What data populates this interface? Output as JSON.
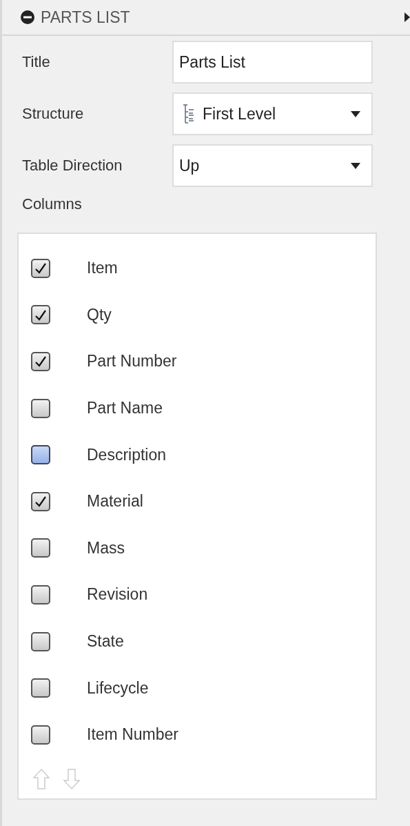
{
  "panel": {
    "title": "PARTS LIST",
    "expanded": true
  },
  "fields": [
    {
      "kind": "text",
      "label": "Title",
      "value": "Parts List"
    },
    {
      "kind": "tree_dropdown",
      "label": "Structure",
      "value": "First Level"
    },
    {
      "kind": "dropdown",
      "label": "Table Direction",
      "value": "Up"
    }
  ],
  "columns_label": "Columns",
  "columns": [
    {
      "label": "Item",
      "checked": true,
      "highlighted": false
    },
    {
      "label": "Qty",
      "checked": true,
      "highlighted": false
    },
    {
      "label": "Part Number",
      "checked": true,
      "highlighted": false
    },
    {
      "label": "Part Name",
      "checked": false,
      "highlighted": false
    },
    {
      "label": "Description",
      "checked": false,
      "highlighted": true
    },
    {
      "label": "Material",
      "checked": true,
      "highlighted": false
    },
    {
      "label": "Mass",
      "checked": false,
      "highlighted": false
    },
    {
      "label": "Revision",
      "checked": false,
      "highlighted": false
    },
    {
      "label": "State",
      "checked": false,
      "highlighted": false
    },
    {
      "label": "Lifecycle",
      "checked": false,
      "highlighted": false
    },
    {
      "label": "Item Number",
      "checked": false,
      "highlighted": false
    }
  ],
  "move_buttons": [
    {
      "kind": "up",
      "disabled": true
    },
    {
      "kind": "down",
      "disabled": true
    }
  ]
}
